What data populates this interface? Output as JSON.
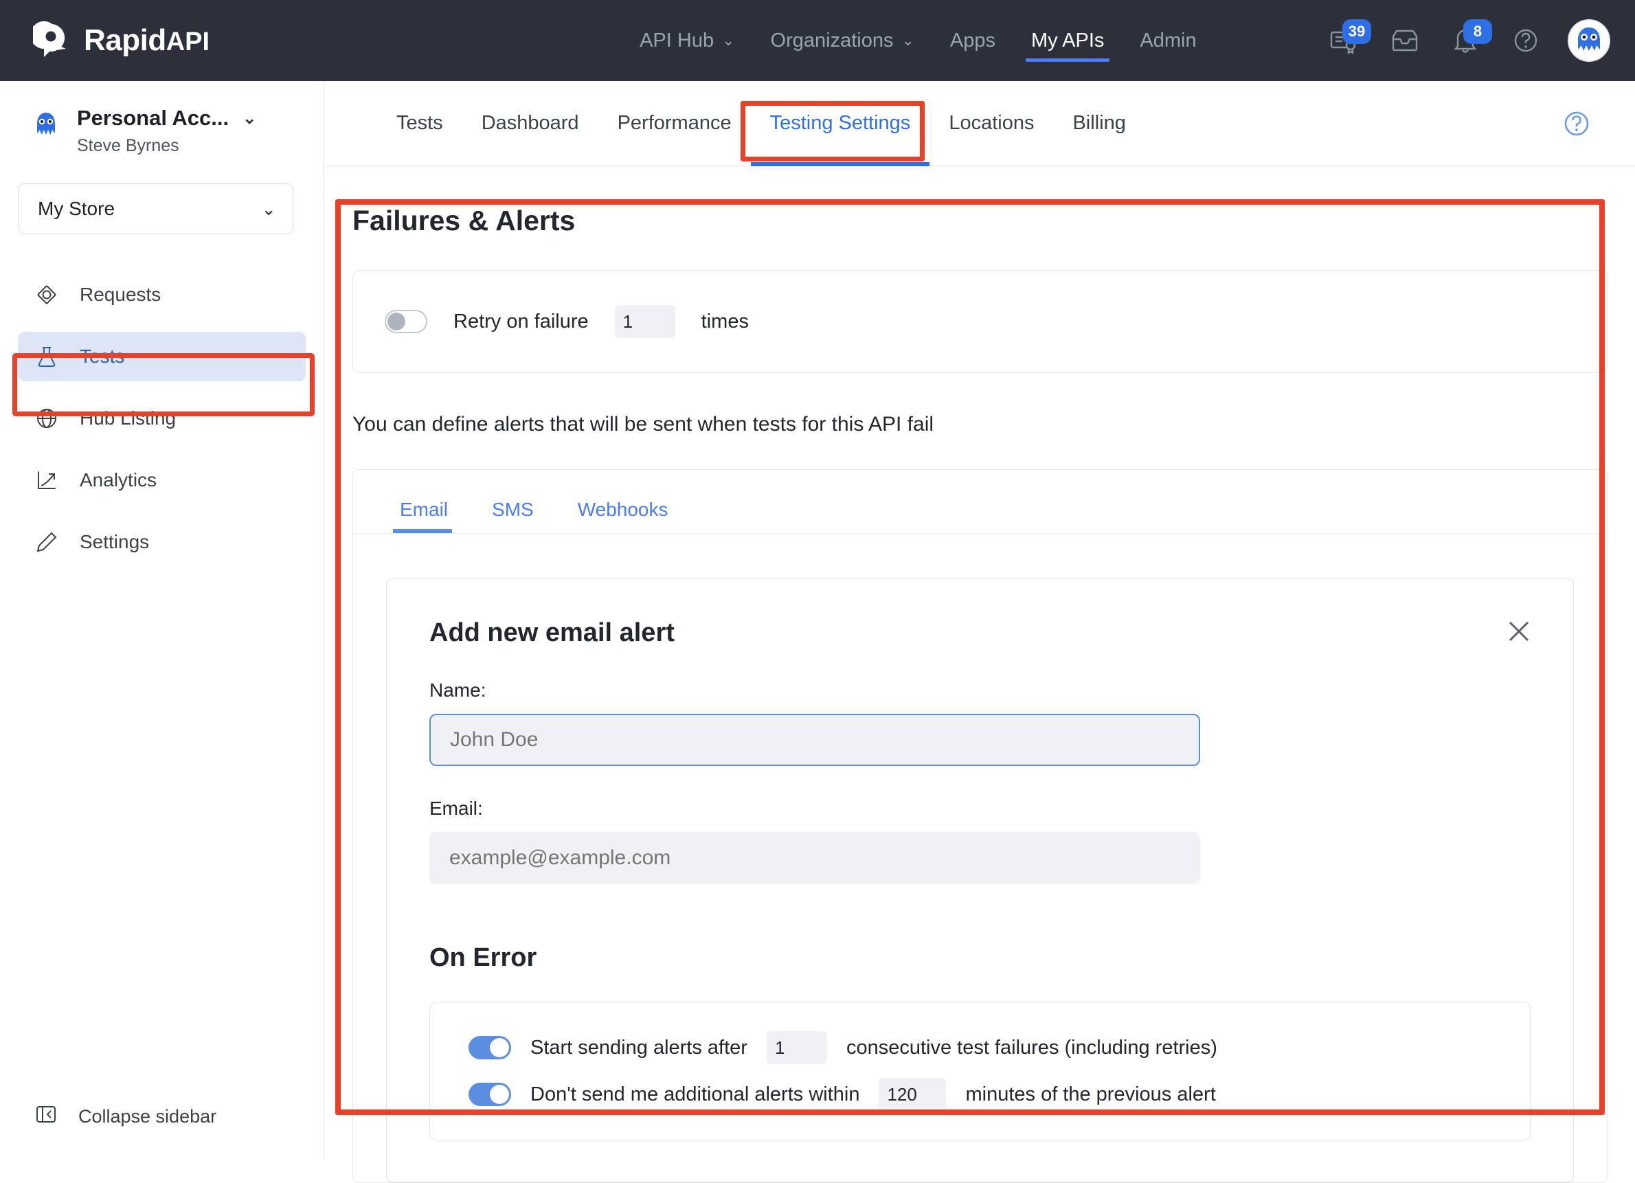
{
  "brand": {
    "name": "Rapid",
    "suffix": "API",
    "logo_icon": "rapidapi-logo-icon"
  },
  "topnav": {
    "items": [
      {
        "label": "API Hub",
        "has_chevron": true,
        "active": false
      },
      {
        "label": "Organizations",
        "has_chevron": true,
        "active": false
      },
      {
        "label": "Apps",
        "has_chevron": false,
        "active": false
      },
      {
        "label": "My APIs",
        "has_chevron": false,
        "active": true
      },
      {
        "label": "Admin",
        "has_chevron": false,
        "active": false
      }
    ],
    "icons": [
      {
        "name": "certificate-icon",
        "badge": "39"
      },
      {
        "name": "inbox-icon",
        "badge": ""
      },
      {
        "name": "bell-icon",
        "badge": "8"
      },
      {
        "name": "help-circle-icon",
        "badge": ""
      }
    ],
    "avatar_icon": "user-avatar-icon"
  },
  "sidebar": {
    "account_name": "Personal Acc...",
    "account_user": "Steve Byrnes",
    "account_logo_icon": "octopus-avatar-icon",
    "account_chevron_icon": "chevron-down-icon",
    "store_select": {
      "value": "My Store",
      "chevron_icon": "chevron-down-icon"
    },
    "items": [
      {
        "label": "Requests",
        "icon": "target-icon",
        "active": false
      },
      {
        "label": "Tests",
        "icon": "flask-icon",
        "active": true
      },
      {
        "label": "Hub Listing",
        "icon": "globe-icon",
        "active": false
      },
      {
        "label": "Analytics",
        "icon": "chart-line-icon",
        "active": false
      },
      {
        "label": "Settings",
        "icon": "pencil-icon",
        "active": false
      }
    ],
    "collapse": {
      "label": "Collapse sidebar",
      "icon": "panel-collapse-icon"
    }
  },
  "main": {
    "tabs": [
      {
        "label": "Tests",
        "active": false
      },
      {
        "label": "Dashboard",
        "active": false
      },
      {
        "label": "Performance",
        "active": false
      },
      {
        "label": "Testing Settings",
        "active": true
      },
      {
        "label": "Locations",
        "active": false
      },
      {
        "label": "Billing",
        "active": false
      }
    ],
    "help_icon": "help-circle-icon",
    "section_title": "Failures & Alerts",
    "retry": {
      "toggle_state": "off",
      "label_before": "Retry on failure",
      "value": "1",
      "label_after": "times"
    },
    "define_text": "You can define alerts that will be sent when tests for this API fail",
    "alert_tabs": [
      {
        "label": "Email",
        "active": true
      },
      {
        "label": "SMS",
        "active": false
      },
      {
        "label": "Webhooks",
        "active": false
      }
    ],
    "panel": {
      "title": "Add new email alert",
      "close_icon": "close-icon",
      "name_label": "Name:",
      "name_placeholder": "John Doe",
      "name_value": "",
      "email_label": "Email:",
      "email_placeholder": "example@example.com",
      "email_value": "",
      "on_error_title": "On Error",
      "rules": [
        {
          "toggle_state": "on",
          "label_before": "Start sending alerts after",
          "value": "1",
          "label_after": "consecutive test failures (including retries)"
        },
        {
          "toggle_state": "on",
          "label_before": "Don't send me additional alerts within",
          "value": "120",
          "label_after": "minutes of the previous alert"
        }
      ]
    }
  },
  "highlights": {
    "color": "#e8412a"
  }
}
